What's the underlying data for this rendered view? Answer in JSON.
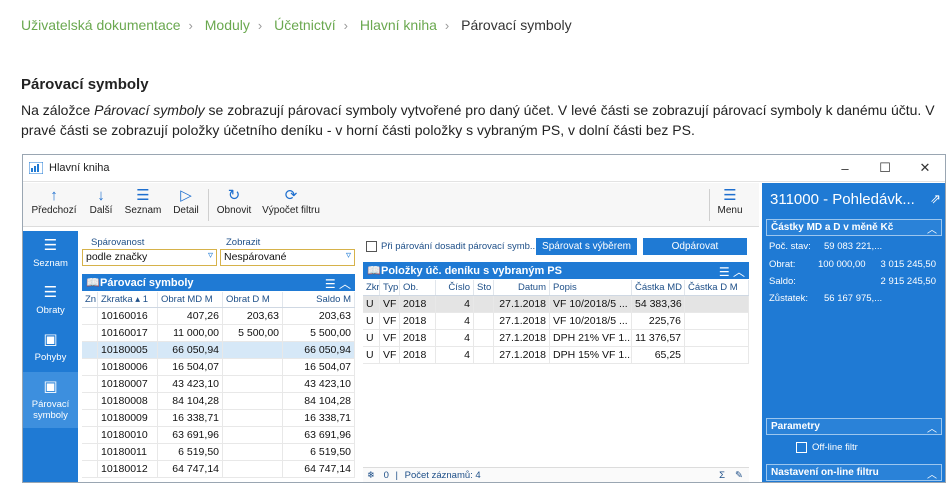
{
  "breadcrumb": [
    "Uživatelská dokumentace",
    "Moduly",
    "Účetnictví",
    "Hlavní kniha",
    "Párovací symboly"
  ],
  "heading": "Párovací symboly",
  "paragraph": {
    "before": "Na záložce ",
    "italic": "Párovací symboly",
    "after": " se zobrazují párovací symboly vytvořené pro daný účet. V levé části se zobrazují párovací symboly k danému účtu. V pravé části se zobrazují položky účetního deníku - v horní části položky s vybraným PS, v dolní části bez PS."
  },
  "window": {
    "title": "Hlavní kniha",
    "controls": [
      "–",
      "☐",
      "✕"
    ]
  },
  "toolbar": [
    {
      "label": "Předchozí",
      "icon": "arrow-up-icon",
      "glyph": "↑"
    },
    {
      "label": "Další",
      "icon": "arrow-down-icon",
      "glyph": "↓"
    },
    {
      "label": "Seznam",
      "icon": "list-icon",
      "glyph": "☰"
    },
    {
      "label": "Detail",
      "icon": "play-icon",
      "glyph": "▷"
    },
    {
      "label": "Obnovit",
      "icon": "refresh-icon",
      "glyph": "↻"
    },
    {
      "label": "Výpočet filtru",
      "icon": "calc-filter-icon",
      "glyph": "⟳"
    },
    {
      "label": "Menu",
      "icon": "hamburger-icon",
      "glyph": "☰"
    }
  ],
  "leftnav": [
    {
      "label": "Seznam",
      "glyph": "☰"
    },
    {
      "label": "Obraty",
      "glyph": "☰"
    },
    {
      "label": "Pohyby",
      "glyph": "▣"
    },
    {
      "label": "Párovací symboly",
      "glyph": "▣"
    }
  ],
  "filters": {
    "sparovanost_label": "Spárovanost",
    "sparovanost_value": "podle značky",
    "zobrazit_label": "Zobrazit",
    "zobrazit_value": "Nespárované"
  },
  "left_grid": {
    "title": "Párovací symboly",
    "columns": [
      "Zn",
      "Zkratka ▴ 1",
      "Obrat MD M",
      "Obrat D M",
      "Saldo M"
    ],
    "rows": [
      [
        "",
        "10160016",
        "407,26",
        "203,63",
        "203,63"
      ],
      [
        "",
        "10160017",
        "11 000,00",
        "5 500,00",
        "5 500,00"
      ],
      [
        "",
        "10180005",
        "66 050,94",
        "",
        "66 050,94"
      ],
      [
        "",
        "10180006",
        "16 504,07",
        "",
        "16 504,07"
      ],
      [
        "",
        "10180007",
        "43 423,10",
        "",
        "43 423,10"
      ],
      [
        "",
        "10180008",
        "84 104,28",
        "",
        "84 104,28"
      ],
      [
        "",
        "10180009",
        "16 338,71",
        "",
        "16 338,71"
      ],
      [
        "",
        "10180010",
        "63 691,96",
        "",
        "63 691,96"
      ],
      [
        "",
        "10180011",
        "6 519,50",
        "",
        "6 519,50"
      ],
      [
        "",
        "10180012",
        "64 747,14",
        "",
        "64 747,14"
      ]
    ]
  },
  "mid": {
    "checkbox_label": "Při párování dosadit párovací symb...",
    "btn_pair": "Spárovat s výběrem",
    "btn_unpair": "Odpárovat"
  },
  "right_grid": {
    "title": "Položky úč. deníku s vybraným PS",
    "columns": [
      "Zkr",
      "Typ",
      "Ob.",
      "Číslo",
      "Sto",
      "Datum",
      "Popis",
      "Částka MD",
      "Částka D M"
    ],
    "rows": [
      [
        "U",
        "VF",
        "2018",
        "4",
        "",
        "27.1.2018",
        "VF 10/2018/5 ...",
        "54 383,36",
        ""
      ],
      [
        "U",
        "VF",
        "2018",
        "4",
        "",
        "27.1.2018",
        "VF 10/2018/5 ...",
        "225,76",
        ""
      ],
      [
        "U",
        "VF",
        "2018",
        "4",
        "",
        "27.1.2018",
        "DPH 21% VF 1...",
        "11 376,57",
        ""
      ],
      [
        "U",
        "VF",
        "2018",
        "4",
        "",
        "27.1.2018",
        "DPH 15% VF 1...",
        "65,25",
        ""
      ]
    ],
    "status_count": "0",
    "status_text": "Počet záznamů: 4"
  },
  "detail": {
    "title": "311000 - Pohledávk...",
    "section": "Částky MD a D v měně Kč",
    "rows": [
      {
        "k": "Poč. stav:",
        "v1": "59 083 221,...",
        "v2": ""
      },
      {
        "k": "Obrat:",
        "v1": "100 000,00",
        "v2": "3 015 245,50"
      },
      {
        "k": "Saldo:",
        "v1": "",
        "v2": "2 915 245,50"
      },
      {
        "k": "Zůstatek:",
        "v1": "56 167 975,...",
        "v2": ""
      }
    ],
    "params": "Parametry",
    "offline": "Off-line filtr",
    "online": "Nastavení on-line filtru"
  }
}
